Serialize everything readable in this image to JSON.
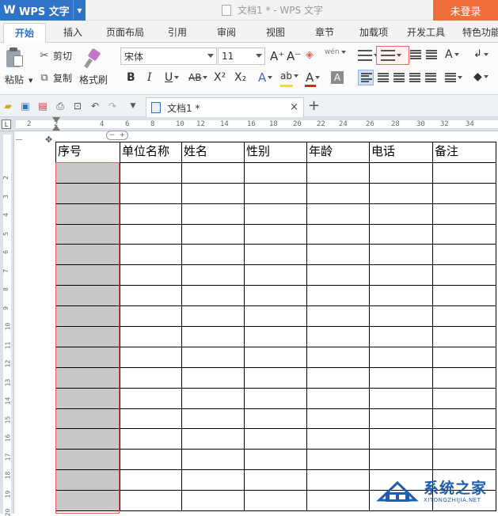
{
  "app": {
    "name": "WPS 文字",
    "logo_glyph": "W",
    "window_title": "文档1 * - WPS 文字",
    "login_label": "未登录",
    "accent": "#2f73c7",
    "login_color": "#ef6e3b"
  },
  "ribbon_tabs": [
    "开始",
    "插入",
    "页面布局",
    "引用",
    "审阅",
    "视图",
    "章节",
    "加载项",
    "开发工具",
    "特色功能"
  ],
  "active_tab": "开始",
  "clipboard": {
    "paste": "粘贴",
    "cut": "剪切",
    "copy": "复制",
    "format_painter": "格式刷"
  },
  "font": {
    "family": "宋体",
    "size": "11",
    "grow": "A⁺",
    "shrink": "A⁻",
    "wen": "wén"
  },
  "format": {
    "bold": "B",
    "italic": "I",
    "underline": "U",
    "strike": "AB",
    "superscript": "X²",
    "subscript": "X₂",
    "effects": "A",
    "highlight": "ab",
    "font_color": "A",
    "char_shading": "A",
    "font_color_hex": "#e02020",
    "highlight_hex": "#f5e600"
  },
  "doc_tab": {
    "name": "文档1 *",
    "close": "×",
    "new": "+"
  },
  "hruler_ticks": [
    "2",
    "2",
    "4",
    "6",
    "8",
    "10",
    "12",
    "14",
    "16",
    "18",
    "20",
    "22",
    "24",
    "26",
    "28",
    "30",
    "32",
    "34"
  ],
  "vruler_ticks": [
    "2",
    "3",
    "4",
    "5",
    "6",
    "7",
    "8",
    "9",
    "10",
    "11",
    "12",
    "13",
    "14",
    "15",
    "16",
    "17",
    "18",
    "19",
    "20"
  ],
  "table": {
    "headers": [
      "序号",
      "单位名称",
      "姓名",
      "性别",
      "年龄",
      "电话",
      "备注"
    ],
    "empty_rows": 17
  },
  "watermark": {
    "title": "系统之家",
    "subtitle": "XITONGZHIJIA.NET"
  }
}
